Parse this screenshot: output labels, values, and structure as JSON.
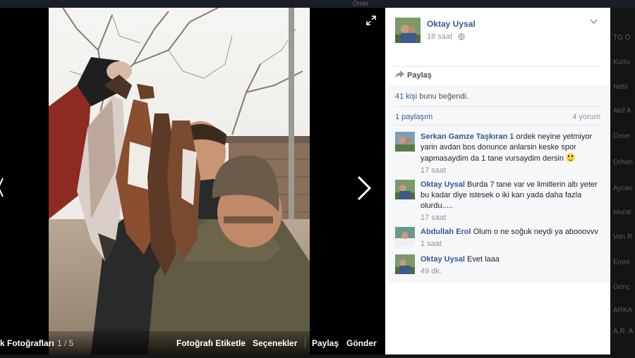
{
  "background": {
    "right_names": [
      "TG Ö",
      "Kurtu",
      "Nebi",
      "Akif A",
      "Ömer",
      "Orhan",
      "Aycan",
      "Murat",
      "Von R",
      "Emre",
      "Genç",
      "ARKA",
      "A.R. A"
    ],
    "top_text": "Ömer"
  },
  "photo_viewer": {
    "album_title": "k Fotoğrafları",
    "page_count": "1 / 5",
    "actions": {
      "tag": "Fotoğrafı Etiketle",
      "options": "Seçenekler",
      "share": "Paylaş",
      "send": "Gönder"
    }
  },
  "post": {
    "author": "Oktay Uysal",
    "time": "18 saat",
    "share_label": "Paylaş",
    "likes_count": "41 kişi",
    "likes_text": " bunu beğendi.",
    "shares": "1 paylaşım",
    "comments_count": "4 yorum"
  },
  "comments": [
    {
      "author": "Serkan Gamze Taşkıran",
      "text": "1 ordek neyine yetmiyor yarin avdan bos donunce anlarsin keske spor yapmasaydim da 1 tane vursaydim dersin",
      "time": "17 saat"
    },
    {
      "author": "Oktay Uysal",
      "text": "Burda 7 tane var ve limitlerin altı yeter bu kadar diye istesek o iki karı yada daha fazla olurdu.....",
      "time": "17 saat"
    },
    {
      "author": "Abdullah Erol",
      "text": "Olum o ne soğuk neydi ya abooovvv",
      "time": "1 saat"
    },
    {
      "author": "Oktay Uysal",
      "text": "Evet laaa",
      "time": "49 dk."
    }
  ],
  "colors": {
    "link": "#365899",
    "panel_bg": "#ffffff",
    "gray_bg": "#f6f7f9",
    "viewer_bg": "#000000"
  }
}
